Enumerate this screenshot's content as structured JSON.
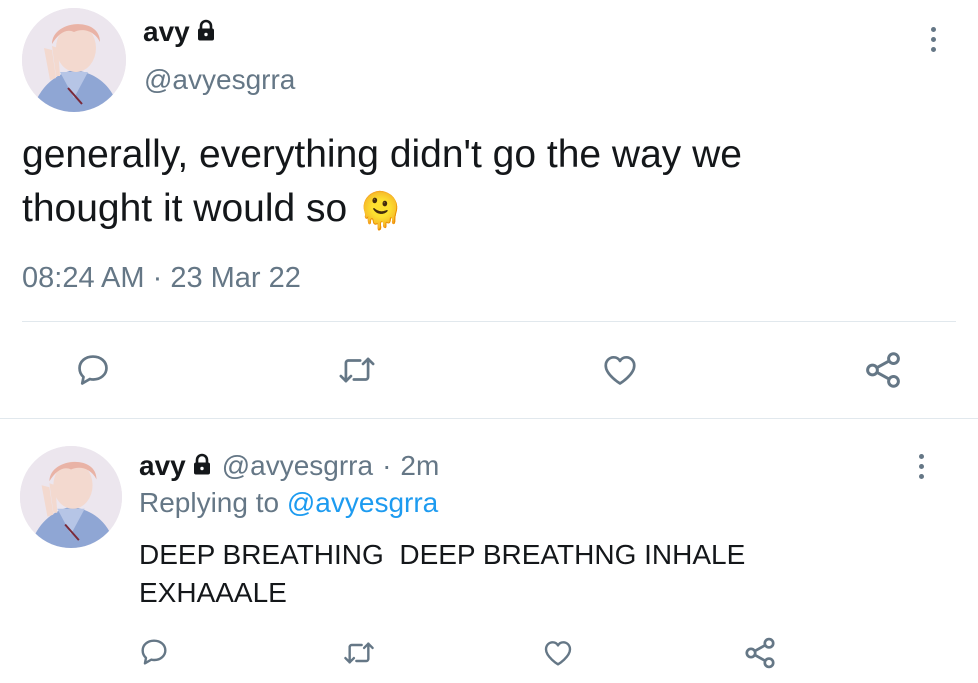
{
  "main_tweet": {
    "display_name": "avy",
    "handle": "@avyesgrra",
    "text_line1": "generally, everything didn't go the way we",
    "text_line2": "thought it would so",
    "emoji": "🫠",
    "time": "08:24 AM",
    "separator": "·",
    "date": "23 Mar 22"
  },
  "reply_tweet": {
    "display_name": "avy",
    "handle": "@avyesgrra",
    "separator": "·",
    "age": "2m",
    "replying_label": "Replying to",
    "replying_handle": "@avyesgrra",
    "text_line1": "DEEP BREATHING  DEEP BREATHNG INHALE",
    "text_line2": "EXHAAALE"
  },
  "icons": {
    "reply": "speech-bubble",
    "retweet": "retweet-arrows",
    "like": "heart",
    "share": "share-nodes",
    "lock": "padlock",
    "more": "vertical-ellipsis"
  },
  "colors": {
    "text": "#14171a",
    "muted": "#657786",
    "link": "#1d9bf0",
    "divider": "#e1e8ed"
  }
}
